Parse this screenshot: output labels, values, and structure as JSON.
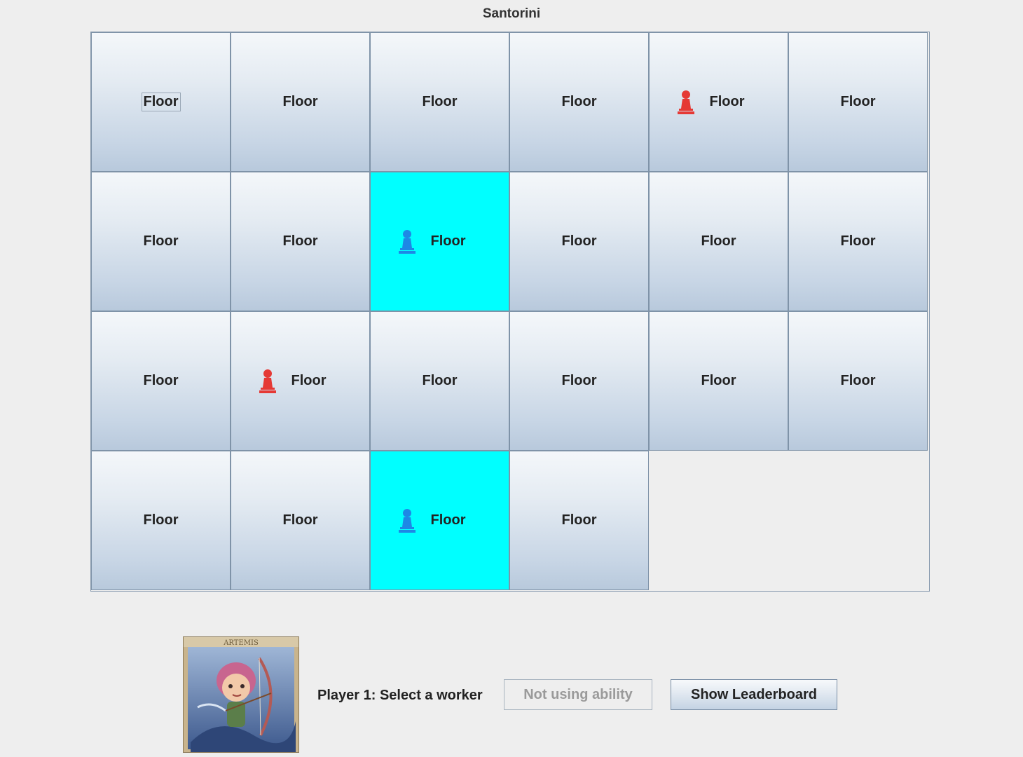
{
  "window": {
    "title": "Santorini"
  },
  "board": {
    "rows": 4,
    "cols": 6,
    "cells": [
      {
        "label": "Floor",
        "worker": null,
        "highlighted": false
      },
      {
        "label": "Floor",
        "worker": null,
        "highlighted": false
      },
      {
        "label": "Floor",
        "worker": null,
        "highlighted": false
      },
      {
        "label": "Floor",
        "worker": null,
        "highlighted": false
      },
      {
        "label": "Floor",
        "worker": "red",
        "highlighted": false
      },
      {
        "label": "Floor",
        "worker": null,
        "highlighted": false
      },
      {
        "label": "Floor",
        "worker": null,
        "highlighted": false
      },
      {
        "label": "Floor",
        "worker": null,
        "highlighted": false
      },
      {
        "label": "Floor",
        "worker": "blue",
        "highlighted": true
      },
      {
        "label": "Floor",
        "worker": null,
        "highlighted": false
      },
      {
        "label": "Floor",
        "worker": null,
        "highlighted": false
      },
      {
        "label": "Floor",
        "worker": null,
        "highlighted": false
      },
      {
        "label": "Floor",
        "worker": null,
        "highlighted": false
      },
      {
        "label": "Floor",
        "worker": "red",
        "highlighted": false
      },
      {
        "label": "Floor",
        "worker": null,
        "highlighted": false
      },
      {
        "label": "Floor",
        "worker": null,
        "highlighted": false
      },
      {
        "label": "Floor",
        "worker": null,
        "highlighted": false
      },
      {
        "label": "Floor",
        "worker": null,
        "highlighted": false
      },
      {
        "label": "Floor",
        "worker": null,
        "highlighted": false
      },
      {
        "label": "Floor",
        "worker": null,
        "highlighted": false
      },
      {
        "label": "Floor",
        "worker": "blue",
        "highlighted": true
      },
      {
        "label": "Floor",
        "worker": null,
        "highlighted": false
      }
    ],
    "colors": {
      "highlight": "#00ffff",
      "red_worker": "#e53935",
      "blue_worker": "#1e88e5"
    }
  },
  "god_card": {
    "name": "ARTEMIS"
  },
  "status_text": "Player 1: Select a worker",
  "buttons": {
    "ability_label": "Not using ability",
    "leaderboard_label": "Show Leaderboard"
  }
}
